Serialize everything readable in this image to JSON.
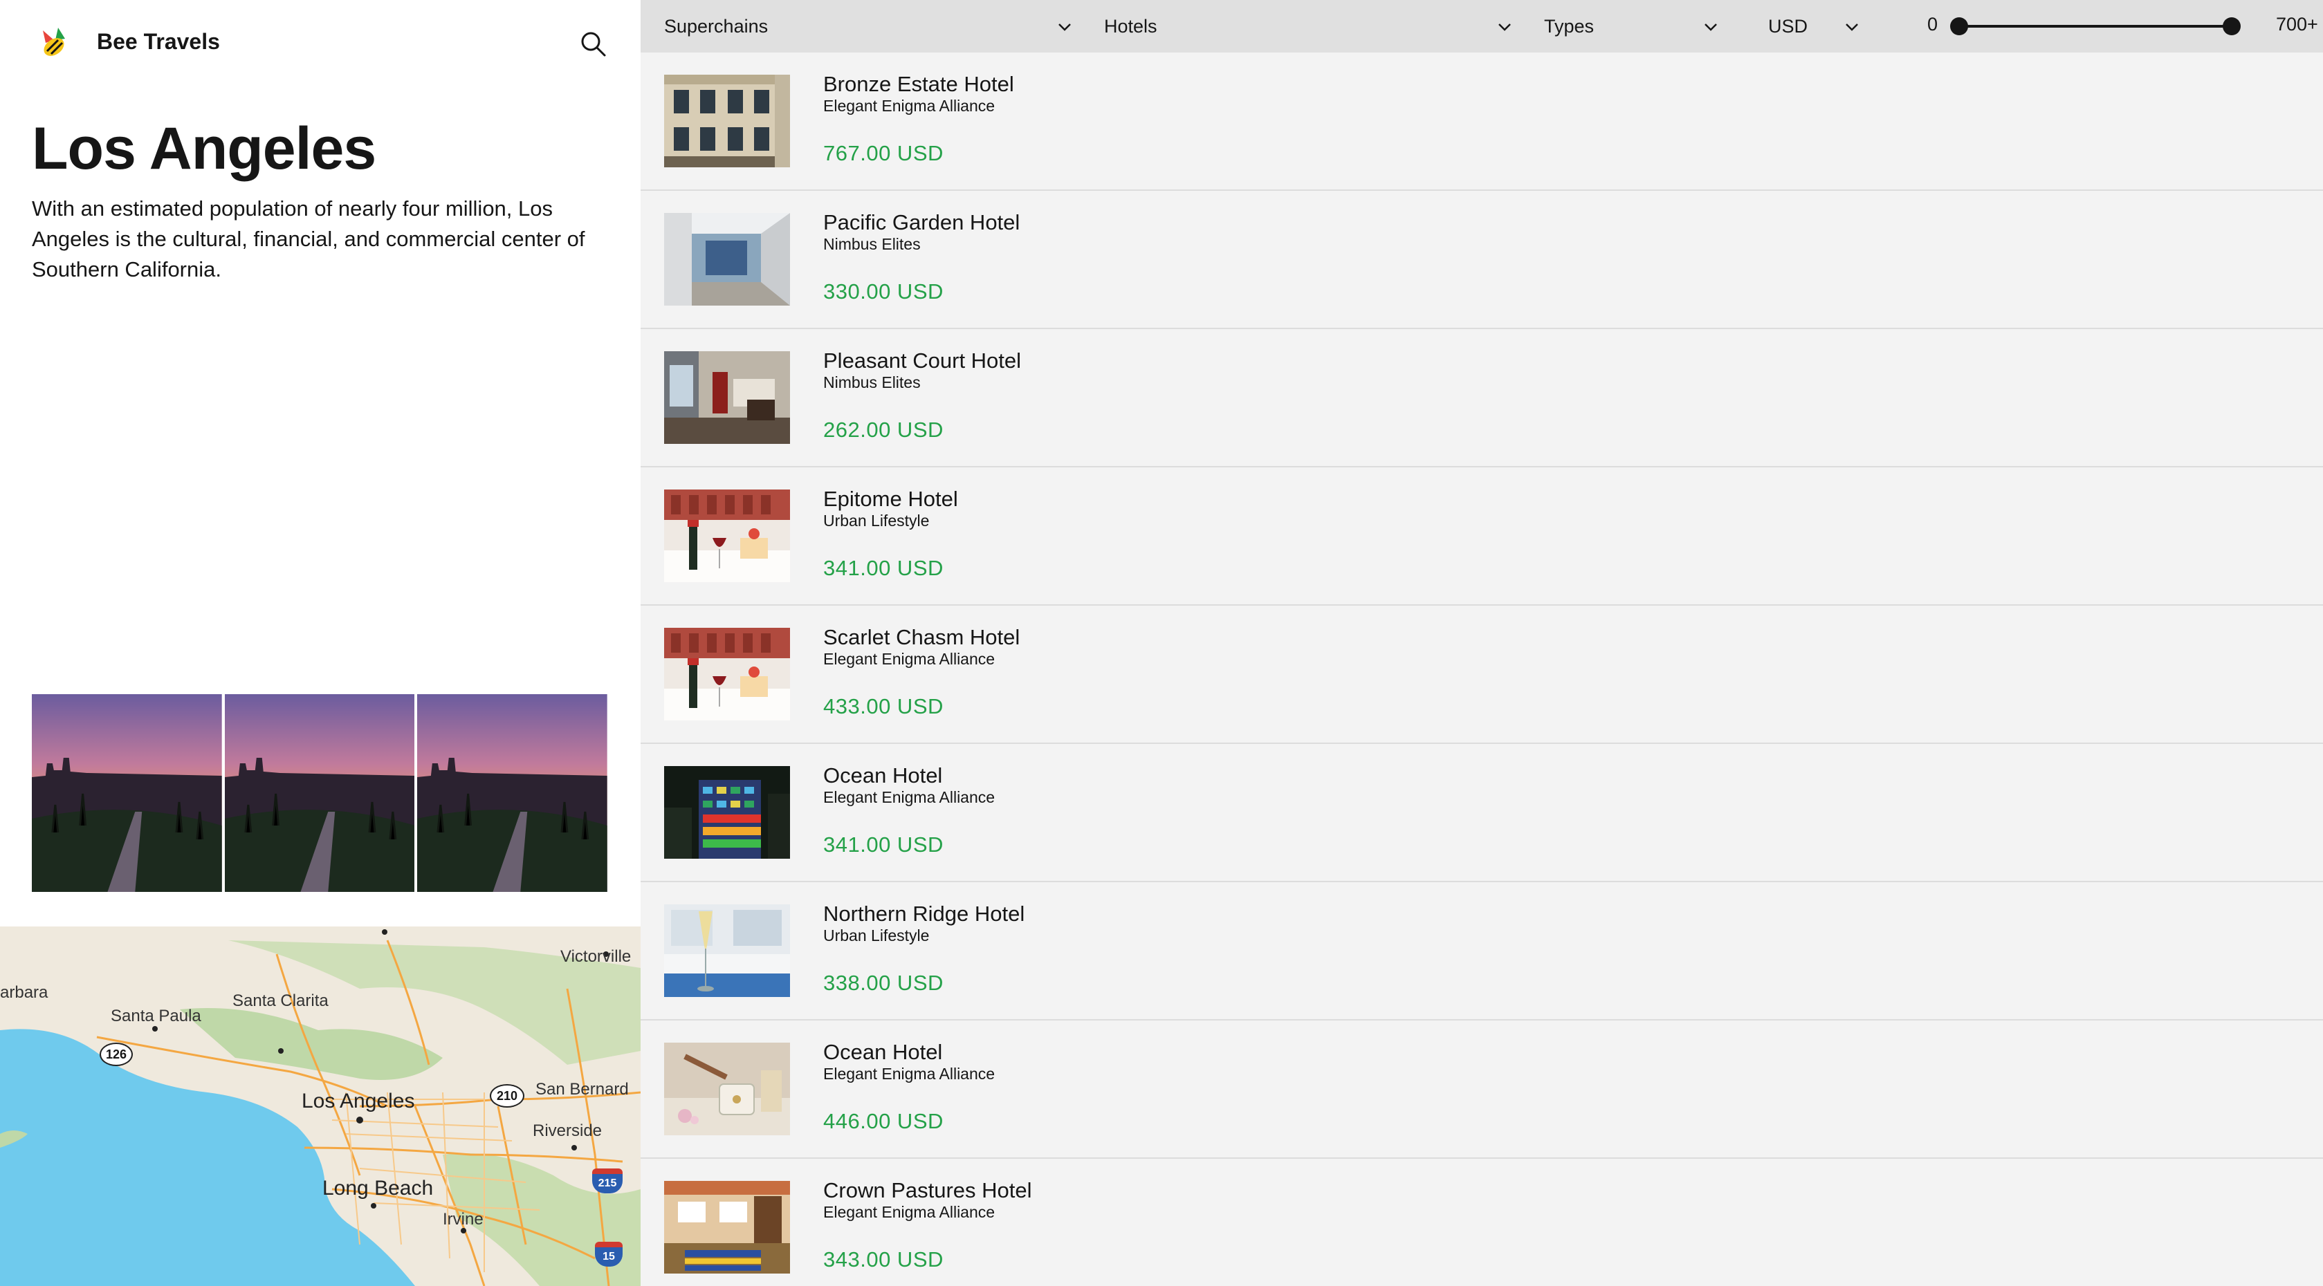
{
  "app": {
    "name": "Bee Travels",
    "logo_icon": "bee-logo-icon",
    "search_icon": "search-icon"
  },
  "city": {
    "title": "Los Angeles",
    "description": "With an estimated population of nearly four million, Los Angeles is the cultural, financial, and commercial center of Southern California."
  },
  "gallery": {
    "image_count": 3
  },
  "map": {
    "labels": {
      "victorville": "Victorville",
      "barbara": "arbara",
      "santa_paula": "Santa Paula",
      "santa_clarita": "Santa Clarita",
      "los_angeles": "Los Angeles",
      "san_bernard": "San Bernard",
      "riverside": "Riverside",
      "long_beach": "Long Beach",
      "irvine": "Irvine"
    },
    "shields": {
      "r126": "126",
      "r210": "210",
      "i215": "215",
      "i15": "15"
    },
    "colors": {
      "water": "#6fcaed",
      "land": "#efe9dd",
      "hills": "#bfd8a8",
      "roads": "#f4a742"
    }
  },
  "filters": {
    "superchains": "Superchains",
    "hotels": "Hotels",
    "types": "Types",
    "currency": "USD",
    "price_min": "0",
    "price_max": "700+",
    "price_range_fraction": [
      0,
      1
    ]
  },
  "hotels": [
    {
      "name": "Bronze Estate Hotel",
      "chain": "Elegant Enigma Alliance",
      "price": "767.00 USD",
      "thumb": "building"
    },
    {
      "name": "Pacific Garden Hotel",
      "chain": "Nimbus Elites",
      "price": "330.00 USD",
      "thumb": "lobby"
    },
    {
      "name": "Pleasant Court Hotel",
      "chain": "Nimbus Elites",
      "price": "262.00 USD",
      "thumb": "room"
    },
    {
      "name": "Epitome Hotel",
      "chain": "Urban Lifestyle",
      "price": "341.00 USD",
      "thumb": "wine"
    },
    {
      "name": "Scarlet Chasm Hotel",
      "chain": "Elegant Enigma Alliance",
      "price": "433.00 USD",
      "thumb": "wine"
    },
    {
      "name": "Ocean Hotel",
      "chain": "Elegant Enigma Alliance",
      "price": "341.00 USD",
      "thumb": "night"
    },
    {
      "name": "Northern Ridge Hotel",
      "chain": "Urban Lifestyle",
      "price": "338.00 USD",
      "thumb": "glass"
    },
    {
      "name": "Ocean Hotel",
      "chain": "Elegant Enigma Alliance",
      "price": "446.00 USD",
      "thumb": "spa"
    },
    {
      "name": "Crown Pastures Hotel",
      "chain": "Elegant Enigma Alliance",
      "price": "343.00 USD",
      "thumb": "patio"
    }
  ],
  "colors": {
    "accent_price": "#24a148",
    "filter_bar": "#e0e0e0",
    "list_bg": "#f3f3f3"
  }
}
